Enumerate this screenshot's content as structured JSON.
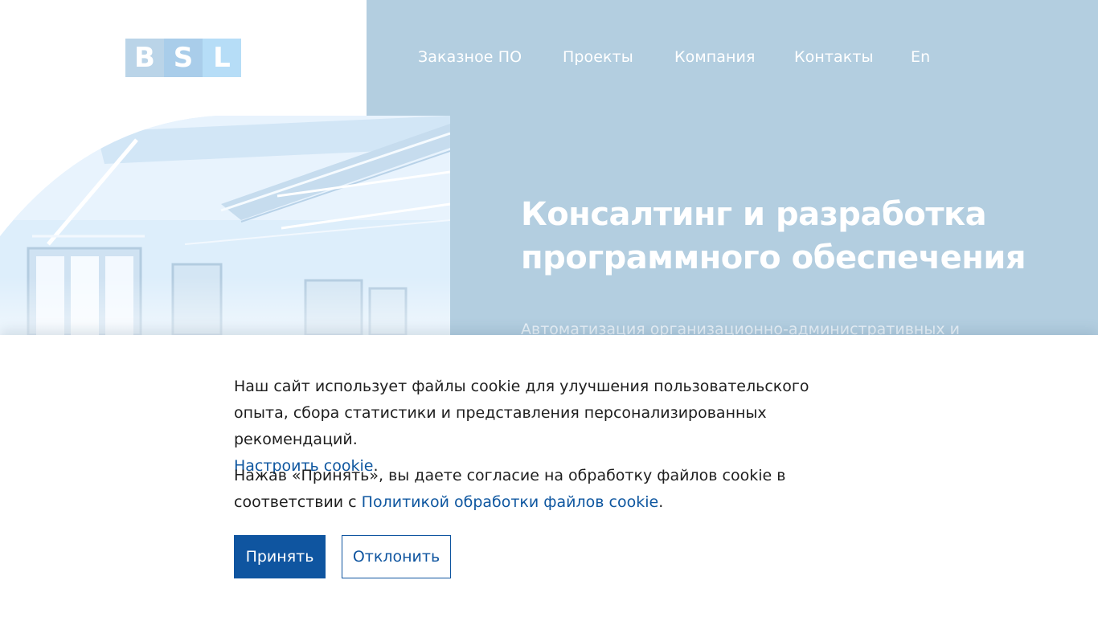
{
  "brand": {
    "logo_letters": [
      "B",
      "S",
      "L"
    ]
  },
  "nav": {
    "items": [
      {
        "label": "Заказное ПО"
      },
      {
        "label": "Проекты"
      },
      {
        "label": "Компания"
      },
      {
        "label": "Контакты"
      },
      {
        "label": "En"
      }
    ]
  },
  "hero": {
    "title_line1": "Консалтинг и разработка",
    "title_line2": "программного обеспечения",
    "subtitle": "Автоматизация организационно-административных и"
  },
  "cookie_banner": {
    "text1": "Наш сайт использует файлы cookie для улучшения пользовательского опыта, сбора статистики и представления персонализированных рекомендаций.",
    "settings_link": "Настроить cookie",
    "text2_prefix": "Нажав «Принять», вы даете согласие на обработку файлов cookie в соответствии с",
    "policy_link": "Политикой обработки файлов cookie",
    "period": ".",
    "accept_label": "Принять",
    "decline_label": "Отклонить"
  },
  "colors": {
    "panel": "#b3cee0",
    "accent": "#0f55a0",
    "text": "#1e1e1e"
  }
}
